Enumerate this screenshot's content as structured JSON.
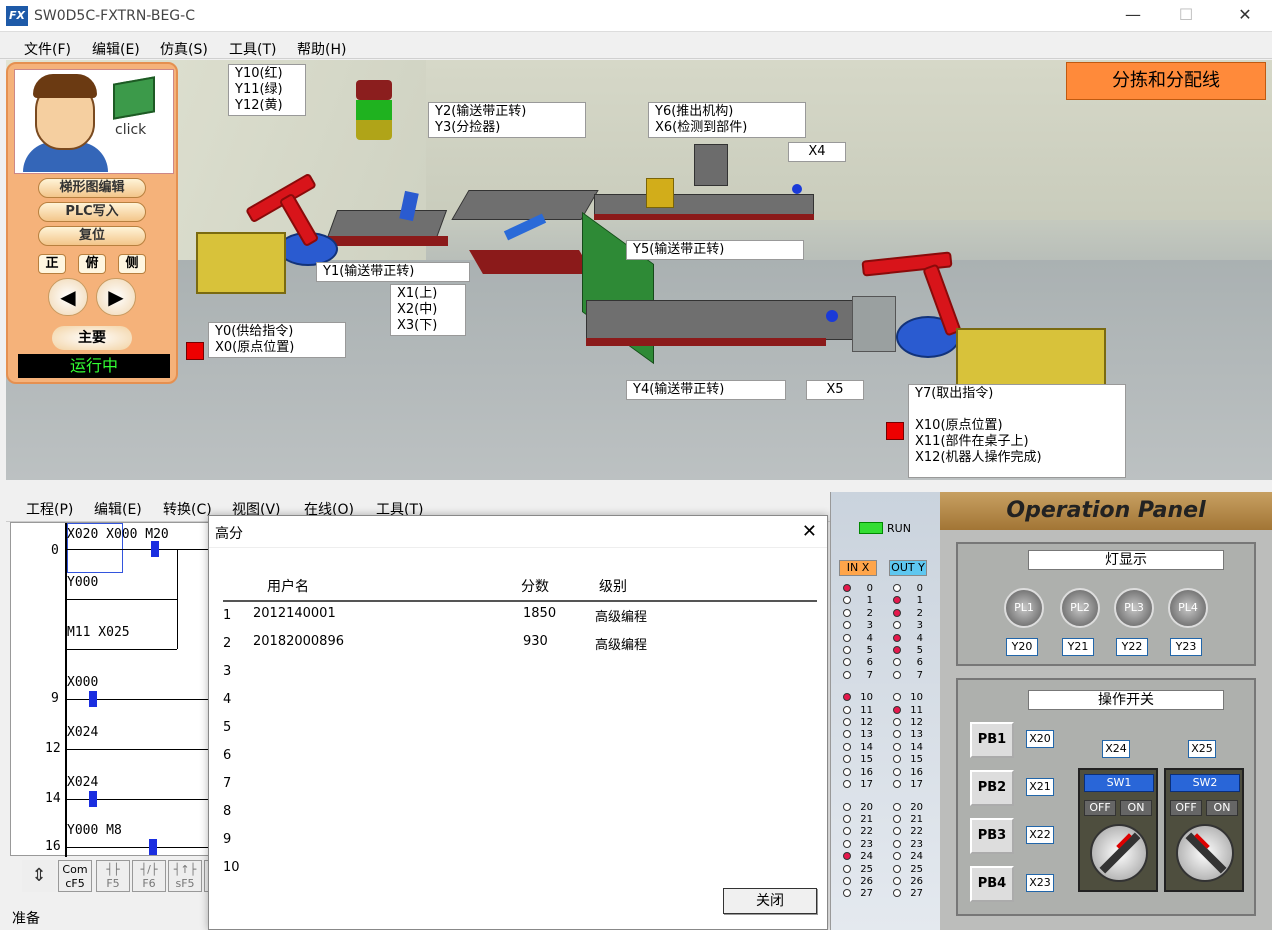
{
  "window": {
    "title": "SW0D5C-FXTRN-BEG-C",
    "logo": "FX",
    "minimize": "—",
    "maximize": "☐",
    "close": "✕"
  },
  "menu": [
    "文件(F)",
    "编辑(E)",
    "仿真(S)",
    "工具(T)",
    "帮助(H)"
  ],
  "left_panel": {
    "click_label": "click",
    "ladder_edit": "梯形图编辑",
    "plc_write": "PLC写入",
    "reset": "复位",
    "views": [
      "正",
      "俯",
      "侧"
    ],
    "prev": "◀",
    "next": "▶",
    "main": "主要",
    "status": "运行中"
  },
  "scene": {
    "title": "分拣和分配线",
    "labels": {
      "lights": "Y10(红)\nY11(绿)\nY12(黄)",
      "y2y3": "Y2(输送带正转)\nY3(分捡器)",
      "y6x6": "Y6(推出机构)\nX6(检测到部件)",
      "x4": "X4",
      "y5": "Y5(输送带正转)",
      "y1": "Y1(输送带正转)",
      "x123": "X1(上)\nX2(中)\nX3(下)",
      "y0x0": "Y0(供给指令)\nX0(原点位置)",
      "y4": "Y4(输送带正转)",
      "x5": "X5",
      "y7": "Y7(取出指令)\n\nX10(原点位置)\nX11(部件在桌子上)\nX12(机器人操作完成)"
    }
  },
  "ladder": {
    "menu": [
      "工程(P)",
      "编辑(E)",
      "转换(C)",
      "视图(V)",
      "在线(O)",
      "工具(T)"
    ],
    "rows": [
      {
        "step": "0",
        "contacts": "X020   X000   M20"
      },
      {
        "step": "",
        "contacts": "Y000"
      },
      {
        "step": "",
        "contacts": "M11    X025"
      },
      {
        "step": "9",
        "contacts": "X000"
      },
      {
        "step": "12",
        "contacts": "X024"
      },
      {
        "step": "14",
        "contacts": "X024"
      },
      {
        "step": "16",
        "contacts": "Y000   M8"
      }
    ],
    "toolbar": [
      {
        "top": "",
        "bottom": ""
      },
      {
        "top": "Com",
        "bottom": "cF5"
      },
      {
        "top": "┤├",
        "bottom": "F5"
      },
      {
        "top": "┤/├",
        "bottom": "F6"
      },
      {
        "top": "┤↑├",
        "bottom": "sF5"
      },
      {
        "top": "",
        "bottom": "s"
      }
    ],
    "status": "准备"
  },
  "dialog": {
    "title": "高分",
    "close_icon": "✕",
    "headers": {
      "user": "用户名",
      "score": "分数",
      "level": "级别"
    },
    "rows": [
      {
        "n": "1",
        "user": "2012140001",
        "score": "1850",
        "level": "高级编程"
      },
      {
        "n": "2",
        "user": "20182000896",
        "score": "930",
        "level": "高级编程"
      },
      {
        "n": "3",
        "user": "",
        "score": "",
        "level": ""
      },
      {
        "n": "4",
        "user": "",
        "score": "",
        "level": ""
      },
      {
        "n": "5",
        "user": "",
        "score": "",
        "level": ""
      },
      {
        "n": "6",
        "user": "",
        "score": "",
        "level": ""
      },
      {
        "n": "7",
        "user": "",
        "score": "",
        "level": ""
      },
      {
        "n": "8",
        "user": "",
        "score": "",
        "level": ""
      },
      {
        "n": "9",
        "user": "",
        "score": "",
        "level": ""
      },
      {
        "n": "10",
        "user": "",
        "score": "",
        "level": ""
      }
    ],
    "close_button": "关闭"
  },
  "io": {
    "run": "RUN",
    "in_header": "IN X",
    "out_header": "OUT Y",
    "groups": [
      [
        "0",
        "1",
        "2",
        "3",
        "4",
        "5",
        "6",
        "7"
      ],
      [
        "10",
        "11",
        "12",
        "13",
        "14",
        "15",
        "16",
        "17"
      ],
      [
        "20",
        "21",
        "22",
        "23",
        "24",
        "25",
        "26",
        "27"
      ]
    ],
    "in_on": [
      "0",
      "10",
      "24"
    ],
    "out_on": [
      "1",
      "2",
      "4",
      "5",
      "11"
    ]
  },
  "op_panel": {
    "title": "Operation Panel",
    "lamp_section": "灯显示",
    "lamps": [
      {
        "name": "PL1",
        "addr": "Y20"
      },
      {
        "name": "PL2",
        "addr": "Y21"
      },
      {
        "name": "PL3",
        "addr": "Y22"
      },
      {
        "name": "PL4",
        "addr": "Y23"
      }
    ],
    "switch_section": "操作开关",
    "buttons": [
      {
        "name": "PB1",
        "addr": "X20"
      },
      {
        "name": "PB2",
        "addr": "X21"
      },
      {
        "name": "PB3",
        "addr": "X22"
      },
      {
        "name": "PB4",
        "addr": "X23"
      }
    ],
    "switches": [
      {
        "name": "SW1",
        "addr": "X24"
      },
      {
        "name": "SW2",
        "addr": "X25"
      }
    ],
    "off": "OFF",
    "on": "ON"
  }
}
